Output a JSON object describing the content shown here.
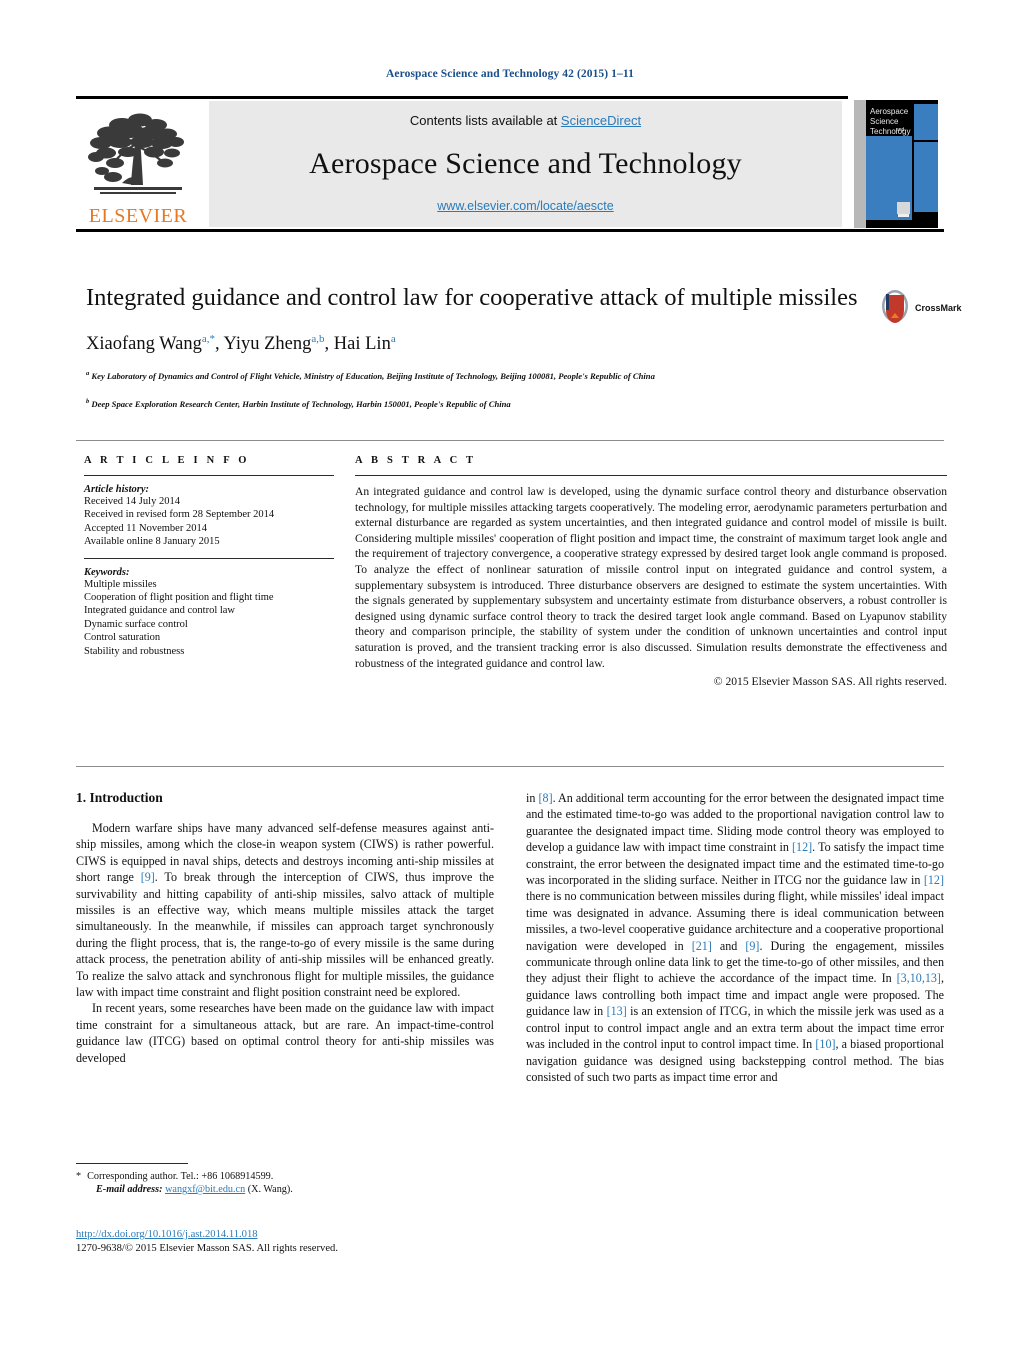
{
  "running_head": "Aerospace Science and Technology 42 (2015) 1–11",
  "masthead": {
    "contents_prefix": "Contents lists available at ",
    "sciencedirect": "ScienceDirect",
    "journal_title": "Aerospace Science and Technology",
    "journal_url": "www.elsevier.com/locate/aescte",
    "publisher_wordmark": "ELSEVIER",
    "cover_line1": "Aerospace",
    "cover_line2": "Science",
    "cover_line3": "and",
    "cover_line4": "Technology"
  },
  "article": {
    "title": "Integrated guidance and control law for cooperative attack of multiple missiles",
    "authors_html": "Xiaofang Wang<sup>a,*</sup>, Yiyu Zheng<sup>a,b</sup>, Hai Lin<sup>a</sup>",
    "affiliation_a": "Key Laboratory of Dynamics and Control of Flight Vehicle, Ministry of Education, Beijing Institute of Technology, Beijing 100081, People's Republic of China",
    "affiliation_b": "Deep Space Exploration Research Center, Harbin Institute of Technology, Harbin 150001, People's Republic of China",
    "crossmark_label": "CrossMark"
  },
  "article_info": {
    "heading": "A R T I C L E   I N F O",
    "history_label": "Article history:",
    "history": [
      "Received 14 July 2014",
      "Received in revised form 28 September 2014",
      "Accepted 11 November 2014",
      "Available online 8 January 2015"
    ],
    "keywords_label": "Keywords:",
    "keywords": [
      "Multiple missiles",
      "Cooperation of flight position and flight time",
      "Integrated guidance and control law",
      "Dynamic surface control",
      "Control saturation",
      "Stability and robustness"
    ]
  },
  "abstract": {
    "heading": "A B S T R A C T",
    "text": "An integrated guidance and control law is developed, using the dynamic surface control theory and disturbance observation technology, for multiple missiles attacking targets cooperatively. The modeling error, aerodynamic parameters perturbation and external disturbance are regarded as system uncertainties, and then integrated guidance and control model of missile is built. Considering multiple missiles' cooperation of flight position and impact time, the constraint of maximum target look angle and the requirement of trajectory convergence, a cooperative strategy expressed by desired target look angle command is proposed. To analyze the effect of nonlinear saturation of missile control input on integrated guidance and control system, a supplementary subsystem is introduced. Three disturbance observers are designed to estimate the system uncertainties. With the signals generated by supplementary subsystem and uncertainty estimate from disturbance observers, a robust controller is designed using dynamic surface control theory to track the desired target look angle command. Based on Lyapunov stability theory and comparison principle, the stability of system under the condition of unknown uncertainties and control input saturation is proved, and the transient tracking error is also discussed. Simulation results demonstrate the effectiveness and robustness of the integrated guidance and control law.",
    "copyright": "© 2015 Elsevier Masson SAS. All rights reserved."
  },
  "body": {
    "section_title": "1. Introduction",
    "left_para_1_html": "Modern warfare ships have many advanced self-defense measures against anti-ship missiles, among which the close-in weapon system (CIWS) is rather powerful. CIWS is equipped in naval ships, detects and destroys incoming anti-ship missiles at short range <span class=\"ref\">[9]</span>. To break through the interception of CIWS, thus improve the survivability and hitting capability of anti-ship missiles, salvo attack of multiple missiles is an effective way, which means multiple missiles attack the target simultaneously. In the meanwhile, if missiles can approach target synchronously during the flight process, that is, the range-to-go of every missile is the same during attack process, the penetration ability of anti-ship missiles will be enhanced greatly. To realize the salvo attack and synchronous flight for multiple missiles, the guidance law with impact time constraint and flight position constraint need be explored.",
    "left_para_2_html": "In recent years, some researches have been made on the guidance law with impact time constraint for a simultaneous attack, but are rare. An impact-time-control guidance law (ITCG) based on optimal control theory for anti-ship missiles was developed",
    "right_para_1_html": "in <span class=\"ref\">[8]</span>. An additional term accounting for the error between the designated impact time and the estimated time-to-go was added to the proportional navigation control law to guarantee the designated impact time. Sliding mode control theory was employed to develop a guidance law with impact time constraint in <span class=\"ref\">[12]</span>. To satisfy the impact time constraint, the error between the designated impact time and the estimated time-to-go was incorporated in the sliding surface. Neither in ITCG nor the guidance law in <span class=\"ref\">[12]</span> there is no communication between missiles during flight, while missiles' ideal impact time was designated in advance. Assuming there is ideal communication between missiles, a two-level cooperative guidance architecture and a cooperative proportional navigation were developed in <span class=\"ref\">[21]</span> and <span class=\"ref\">[9]</span>. During the engagement, missiles communicate through online data link to get the time-to-go of other missiles, and then they adjust their flight to achieve the accordance of the impact time. In <span class=\"ref\">[3,10,13]</span>, guidance laws controlling both impact time and impact angle were proposed. The guidance law in <span class=\"ref\">[13]</span> is an extension of ITCG, in which the missile jerk was used as a control input to control impact angle and an extra term about the impact time error was included in the control input to control impact time. In <span class=\"ref\">[10]</span>, a biased proportional navigation guidance was designed using backstepping control method. The bias consisted of such two parts as impact time error and"
  },
  "footnote": {
    "star": "*",
    "corresponding_html": "Corresponding author. Tel.: +86 1068914599.",
    "email_label": "E-mail address:",
    "email": "wangxf@bit.edu.cn",
    "email_suffix": "(X. Wang)."
  },
  "footer": {
    "doi": "http://dx.doi.org/10.1016/j.ast.2014.11.018",
    "issn_line": "1270-9638/© 2015 Elsevier Masson SAS. All rights reserved."
  },
  "colors": {
    "link": "#2b7bb9",
    "elsevier_orange": "#E87722",
    "cover_blue": "#3a7ec0"
  }
}
